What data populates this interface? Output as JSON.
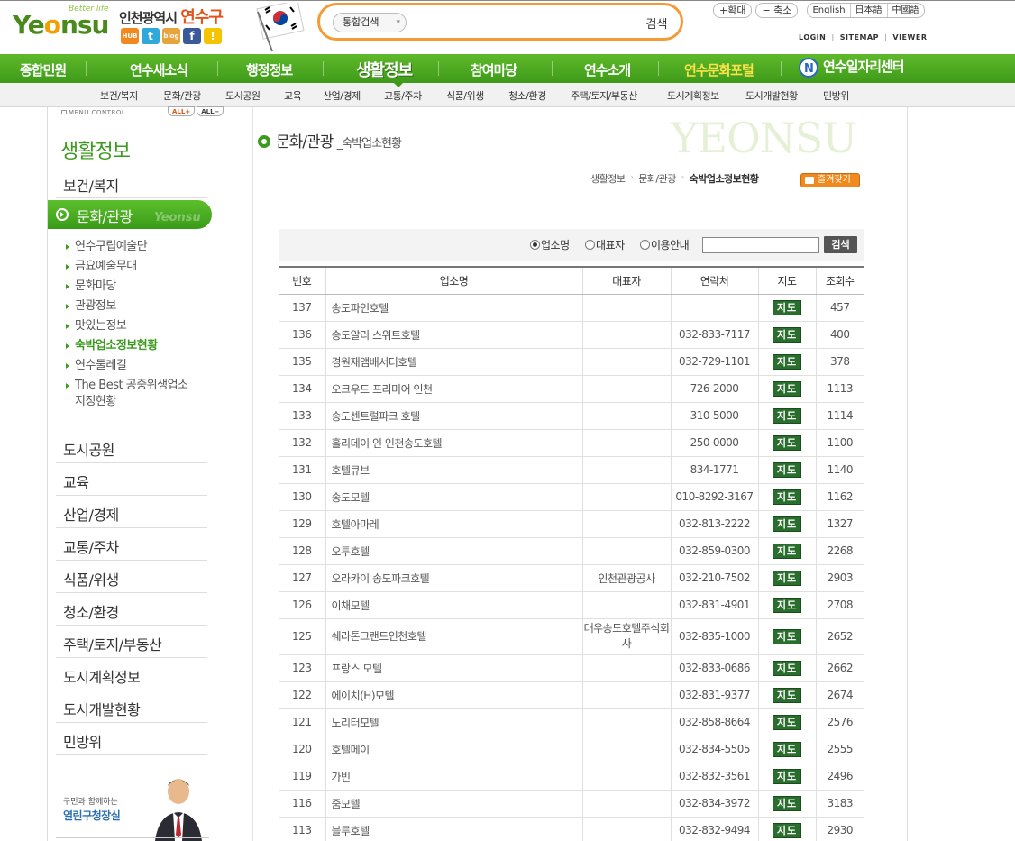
{
  "brand": {
    "logo_text": "Yeonsu",
    "logo_tagline": "Better life",
    "city_prefix": "인천광역시",
    "city_name": "연수구",
    "sns": [
      {
        "label": "HUB",
        "icon": "hub-icon",
        "color": "#f08a1e"
      },
      {
        "label": "t",
        "icon": "twitter-icon",
        "color": "#2fa8dc"
      },
      {
        "label": "blog",
        "icon": "blog-icon",
        "color": "#e8a33c"
      },
      {
        "label": "f",
        "icon": "facebook-icon",
        "color": "#3b5998"
      },
      {
        "label": "!",
        "icon": "me2day-icon",
        "color": "#f5c400"
      }
    ]
  },
  "search": {
    "type_label": "통합검색",
    "button_label": "검색",
    "value": ""
  },
  "utility": {
    "zoom_in": "+확대",
    "zoom_out": "− 축소",
    "languages": [
      "English",
      "日本語",
      "中國語"
    ],
    "login": "LOGIN",
    "sitemap": "SITEMAP",
    "viewer": "VIEWER"
  },
  "gnb": {
    "items": [
      "종합민원",
      "연수새소식",
      "행정정보",
      "생활정보",
      "참여마당",
      "연수소개",
      "연수문화포털",
      "연수일자리센터"
    ],
    "active": "생활정보",
    "jobs_badge": "N"
  },
  "subnav": {
    "items": [
      "보건/복지",
      "문화/관광",
      "도시공원",
      "교육",
      "산업/경제",
      "교통/주차",
      "식품/위생",
      "청소/환경",
      "주택/토지/부동산",
      "도시계획정보",
      "도시개발현황",
      "민방위"
    ]
  },
  "lnb": {
    "menu_control": "MENU CONTROL",
    "all_open": "ALL+",
    "all_close": "ALL−",
    "title": "생활정보",
    "top_item": "보건/복지",
    "active_item": "문화/관광",
    "active_watermark": "Yeonsu",
    "sub_items": [
      "연수구립예술단",
      "금요예술무대",
      "문화마당",
      "관광정보",
      "맛있는정보",
      "숙박업소정보현황",
      "연수둘레길",
      "The Best 공중위생업소 지정현황"
    ],
    "sub_active": "숙박업소정보현황",
    "bottom_items": [
      "도시공원",
      "교육",
      "산업/경제",
      "교통/주차",
      "식품/위생",
      "청소/환경",
      "주택/토지/부동산",
      "도시계획정보",
      "도시개발현황",
      "민방위"
    ],
    "mayor_line1": "구민과 함께하는",
    "mayor_line2": "열린구청장실"
  },
  "content": {
    "watermark": "YEONSU",
    "title": "문화/관광",
    "subtitle": "_숙박업소현황",
    "breadcrumb": [
      "생활정보",
      "문화/관광",
      "숙박업소정보현황"
    ],
    "favorite_label": "즐겨찾기",
    "filter": {
      "options": [
        "업소명",
        "대표자",
        "이용안내"
      ],
      "selected": "업소명",
      "input_value": "",
      "button_label": "검색"
    },
    "table": {
      "columns": [
        "번호",
        "업소명",
        "대표자",
        "연락처",
        "지도",
        "조회수"
      ],
      "map_label": "지도",
      "rows": [
        {
          "no": "137",
          "name": "송도파인호텔",
          "owner": "",
          "phone": "",
          "views": "457"
        },
        {
          "no": "136",
          "name": "송도알리 스위트호텔",
          "owner": "",
          "phone": "032-833-7117",
          "views": "400"
        },
        {
          "no": "135",
          "name": "경원재앰배서더호텔",
          "owner": "",
          "phone": "032-729-1101",
          "views": "378"
        },
        {
          "no": "134",
          "name": "오크우드 프리미어 인천",
          "owner": "",
          "phone": "726-2000",
          "views": "1113"
        },
        {
          "no": "133",
          "name": "송도센트럴파크 호텔",
          "owner": "",
          "phone": "310-5000",
          "views": "1114"
        },
        {
          "no": "132",
          "name": "홀리데이 인 인천송도호텔",
          "owner": "",
          "phone": "250-0000",
          "views": "1100"
        },
        {
          "no": "131",
          "name": "호텔큐브",
          "owner": "",
          "phone": "834-1771",
          "views": "1140"
        },
        {
          "no": "130",
          "name": "송도모텔",
          "owner": "",
          "phone": "010-8292-3167",
          "views": "1162"
        },
        {
          "no": "129",
          "name": "호텔아마레",
          "owner": "",
          "phone": "032-813-2222",
          "views": "1327"
        },
        {
          "no": "128",
          "name": "오투호텔",
          "owner": "",
          "phone": "032-859-0300",
          "views": "2268"
        },
        {
          "no": "127",
          "name": "오라카이 송도파크호텔",
          "owner": "인천관광공사",
          "phone": "032-210-7502",
          "views": "2903"
        },
        {
          "no": "126",
          "name": "이채모텔",
          "owner": "",
          "phone": "032-831-4901",
          "views": "2708"
        },
        {
          "no": "125",
          "name": "쉐라톤그랜드인천호텔",
          "owner": "대우송도호텔주식회사",
          "phone": "032-835-1000",
          "views": "2652",
          "tall": true
        },
        {
          "no": "123",
          "name": "프랑스 모텔",
          "owner": "",
          "phone": "032-833-0686",
          "views": "2662"
        },
        {
          "no": "122",
          "name": "에이치(H)모텔",
          "owner": "",
          "phone": "032-831-9377",
          "views": "2674"
        },
        {
          "no": "121",
          "name": "노리터모텔",
          "owner": "",
          "phone": "032-858-8664",
          "views": "2576"
        },
        {
          "no": "120",
          "name": "호텔메이",
          "owner": "",
          "phone": "032-834-5505",
          "views": "2555"
        },
        {
          "no": "119",
          "name": "가빈",
          "owner": "",
          "phone": "032-832-3561",
          "views": "2496"
        },
        {
          "no": "116",
          "name": "줌모텔",
          "owner": "",
          "phone": "032-834-3972",
          "views": "3183"
        },
        {
          "no": "113",
          "name": "블루호텔",
          "owner": "",
          "phone": "032-832-9494",
          "views": "2930"
        }
      ]
    }
  },
  "colors": {
    "brand_green": "#3f9a1a",
    "accent_orange": "#f59b35",
    "map_button": "#2a6e2e"
  }
}
